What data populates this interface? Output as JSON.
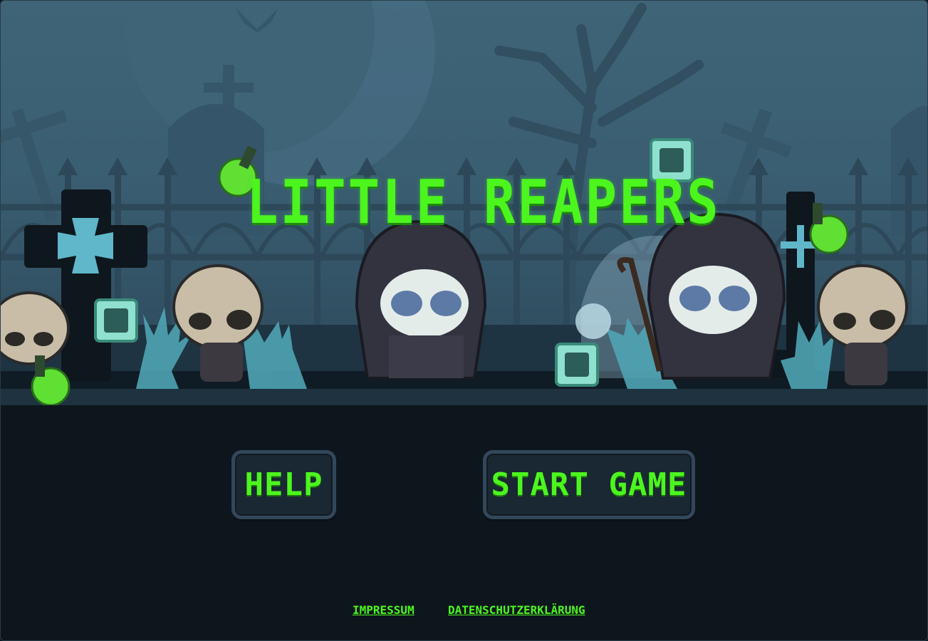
{
  "game": {
    "title": "LITTLE REAPERS"
  },
  "menu": {
    "help_label": "HELP",
    "start_label": "START GAME"
  },
  "footer": {
    "imprint_label": "IMPRESSUM",
    "privacy_label": "DATENSCHUTZERKLÄRUNG"
  },
  "colors": {
    "accent": "#4cf51e",
    "background": "#0d161d",
    "sky": "#3f6478"
  }
}
